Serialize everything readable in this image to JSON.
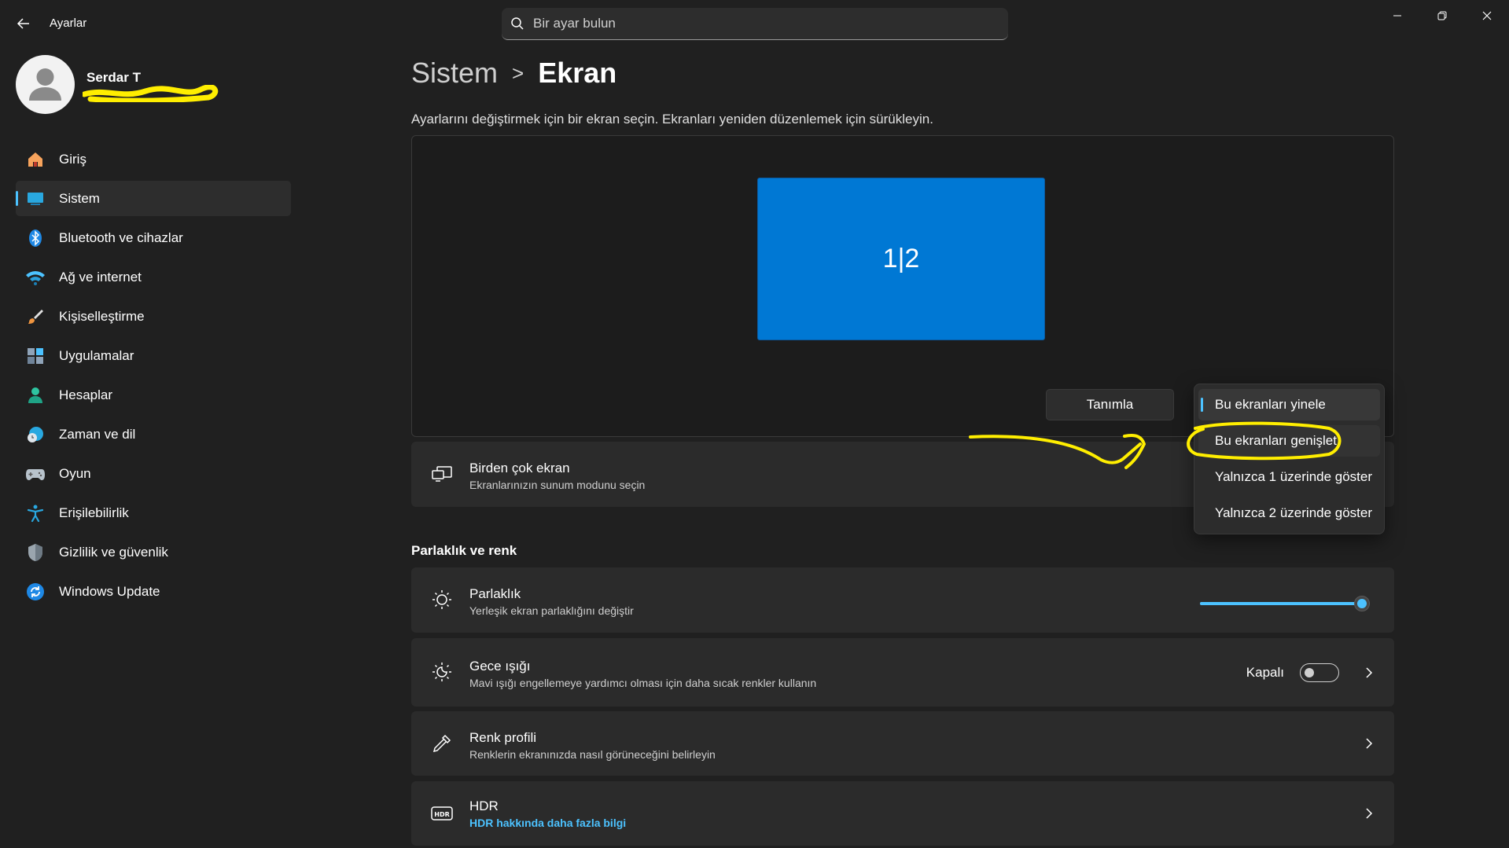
{
  "titlebar": {
    "app_title": "Ayarlar",
    "search_placeholder": "Bir ayar bulun"
  },
  "profile": {
    "name": "Serdar T"
  },
  "sidebar": {
    "items": [
      {
        "label": "Giriş",
        "icon": "home-icon"
      },
      {
        "label": "Sistem",
        "icon": "system-icon",
        "active": true
      },
      {
        "label": "Bluetooth ve cihazlar",
        "icon": "bluetooth-icon"
      },
      {
        "label": "Ağ ve internet",
        "icon": "wifi-icon"
      },
      {
        "label": "Kişiselleştirme",
        "icon": "brush-icon"
      },
      {
        "label": "Uygulamalar",
        "icon": "apps-icon"
      },
      {
        "label": "Hesaplar",
        "icon": "account-icon"
      },
      {
        "label": "Zaman ve dil",
        "icon": "time-language-icon"
      },
      {
        "label": "Oyun",
        "icon": "gamepad-icon"
      },
      {
        "label": "Erişilebilirlik",
        "icon": "accessibility-icon"
      },
      {
        "label": "Gizlilik ve güvenlik",
        "icon": "shield-icon"
      },
      {
        "label": "Windows Update",
        "icon": "update-icon"
      }
    ]
  },
  "main": {
    "breadcrumb_parent": "Sistem",
    "breadcrumb_separator": ">",
    "breadcrumb_current": "Ekran",
    "description": "Ayarlarını değiştirmek için bir ekran seçin. Ekranları yeniden düzenlemek için sürükleyin.",
    "monitor_label": "1|2",
    "identify_label": "Tanımla",
    "multi_display": {
      "title": "Birden çok ekran",
      "subtitle": "Ekranlarınızın sunum modunu seçin"
    },
    "section_brightness": "Parlaklık ve renk",
    "brightness": {
      "title": "Parlaklık",
      "subtitle": "Yerleşik ekran parlaklığını değiştir",
      "value_fraction": 1.0
    },
    "night_light": {
      "title": "Gece ışığı",
      "subtitle": "Mavi ışığı engellemeye yardımcı olması için daha sıcak renkler kullanın",
      "state": "Kapalı"
    },
    "color_profile": {
      "title": "Renk profili",
      "subtitle": "Renklerin ekranınızda nasıl görüneceğini belirleyin"
    },
    "hdr": {
      "title": "HDR",
      "subtitle": "HDR hakkında daha fazla bilgi"
    }
  },
  "dropdown": {
    "options": [
      "Bu ekranları yinele",
      "Bu ekranları genişlet",
      "Yalnızca 1 üzerinde göster",
      "Yalnızca 2 üzerinde göster"
    ],
    "selected_index": 0
  },
  "colors": {
    "accent": "#4cc2ff",
    "monitor_blue": "#0078d4",
    "annotation_yellow": "#ffee00"
  }
}
